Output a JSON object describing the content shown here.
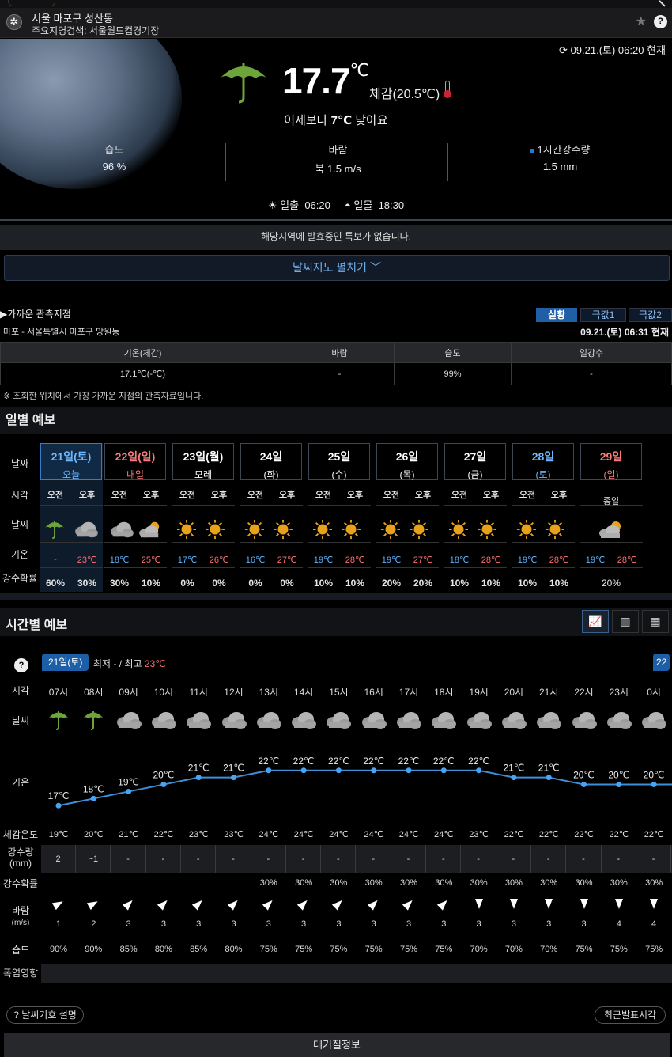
{
  "location": {
    "name": "서울 마포구 성산동",
    "search": "주요지명검색: 서울월드컵경기장"
  },
  "current": {
    "time": "09.21.(토) 06:20 현재",
    "temp": "17.7",
    "unit": "℃",
    "feels": "체감(20.5℃)",
    "compare_prefix": "어제보다",
    "compare_value": "7℃",
    "compare_suffix": "낮아요",
    "humidity_label": "습도",
    "humidity": "96 %",
    "wind_label": "바람",
    "wind": "북 1.5 m/s",
    "rain_label": "1시간강수량",
    "rain": "1.5 mm",
    "sunrise_label": "일출",
    "sunrise": "06:20",
    "sunset_label": "일몰",
    "sunset": "18:30"
  },
  "notice": "해당지역에 발효중인 특보가 없습니다.",
  "map_button": "날씨지도 펼치기",
  "observation": {
    "title": "▶가까운 관측지점",
    "station": "마포 - 서울특별시 마포구 망원동",
    "tabs": [
      "실황",
      "극값1",
      "극값2"
    ],
    "time": "09.21.(토) 06:31 현재",
    "headers": [
      "기온(체감)",
      "바람",
      "습도",
      "일강수"
    ],
    "values": [
      "17.1℃(-℃)",
      "-",
      "99%",
      "-"
    ],
    "note": "※ 조회한 위치에서 가장 가까운 지점의 관측자료입니다."
  },
  "daily": {
    "title": "일별 예보",
    "row_labels": [
      "날짜",
      "시각",
      "날씨",
      "기온",
      "강수확률"
    ],
    "days": [
      {
        "date": "21일(토)",
        "sub": "오늘",
        "am": "오전",
        "pm": "오후",
        "amIcon": "umbrella",
        "pmIcon": "cloud",
        "amT": "-",
        "pmT": "23℃",
        "amP": "60%",
        "pmP": "30%"
      },
      {
        "date": "22일(일)",
        "sub": "내일",
        "am": "오전",
        "pm": "오후",
        "amIcon": "cloud",
        "pmIcon": "suncloud",
        "amT": "18℃",
        "pmT": "25℃",
        "amP": "30%",
        "pmP": "10%"
      },
      {
        "date": "23일(월)",
        "sub": "모레",
        "am": "오전",
        "pm": "오후",
        "amIcon": "sun",
        "pmIcon": "sun",
        "amT": "17℃",
        "pmT": "26℃",
        "amP": "0%",
        "pmP": "0%"
      },
      {
        "date": "24일",
        "sub": "(화)",
        "am": "오전",
        "pm": "오후",
        "amIcon": "sun",
        "pmIcon": "sun",
        "amT": "16℃",
        "pmT": "27℃",
        "amP": "0%",
        "pmP": "0%"
      },
      {
        "date": "25일",
        "sub": "(수)",
        "am": "오전",
        "pm": "오후",
        "amIcon": "sun",
        "pmIcon": "sun",
        "amT": "19℃",
        "pmT": "28℃",
        "amP": "10%",
        "pmP": "10%"
      },
      {
        "date": "26일",
        "sub": "(목)",
        "am": "오전",
        "pm": "오후",
        "amIcon": "sun",
        "pmIcon": "sun",
        "amT": "19℃",
        "pmT": "27℃",
        "amP": "20%",
        "pmP": "20%"
      },
      {
        "date": "27일",
        "sub": "(금)",
        "am": "오전",
        "pm": "오후",
        "amIcon": "sun",
        "pmIcon": "sun",
        "amT": "18℃",
        "pmT": "28℃",
        "amP": "10%",
        "pmP": "10%"
      },
      {
        "date": "28일",
        "sub": "(토)",
        "am": "오전",
        "pm": "오후",
        "amIcon": "sun",
        "pmIcon": "sun",
        "amT": "19℃",
        "pmT": "28℃",
        "amP": "10%",
        "pmP": "10%"
      },
      {
        "date": "29일",
        "sub": "(일)",
        "all": "종일",
        "allIcon": "suncloud",
        "amT": "19℃",
        "pmT": "28℃",
        "allP": "20%"
      }
    ]
  },
  "hourly": {
    "title": "시간별 예보",
    "day_tag": "21일(토)",
    "day_tag_next": "22",
    "minmax_prefix": "최저",
    "min": "-",
    "sep": "/",
    "max_prefix": "최고",
    "max": "23℃",
    "row_labels": {
      "time": "시각",
      "weather": "날씨",
      "temp": "기온",
      "feels": "체감온도",
      "rain": "강수량",
      "rain_unit": "(mm)",
      "prob": "강수확률",
      "wind": "바람",
      "wind_unit": "(m/s)",
      "hum": "습도",
      "heat": "폭염영향"
    },
    "hours": [
      {
        "t": "07시",
        "icon": "umbrella",
        "temp": 17,
        "tl": "17℃",
        "feel": "19℃",
        "rain": "2",
        "prob": "",
        "wdir": 60,
        "ws": "1",
        "hum": "90%"
      },
      {
        "t": "08시",
        "icon": "umbrella",
        "temp": 18,
        "tl": "18℃",
        "feel": "20℃",
        "rain": "~1",
        "prob": "",
        "wdir": 60,
        "ws": "2",
        "hum": "90%"
      },
      {
        "t": "09시",
        "icon": "cloud",
        "temp": 19,
        "tl": "19℃",
        "feel": "21℃",
        "rain": "-",
        "prob": "",
        "wdir": 45,
        "ws": "3",
        "hum": "85%"
      },
      {
        "t": "10시",
        "icon": "cloud",
        "temp": 20,
        "tl": "20℃",
        "feel": "22℃",
        "rain": "-",
        "prob": "",
        "wdir": 45,
        "ws": "3",
        "hum": "80%"
      },
      {
        "t": "11시",
        "icon": "cloud",
        "temp": 21,
        "tl": "21℃",
        "feel": "23℃",
        "rain": "-",
        "prob": "",
        "wdir": 45,
        "ws": "3",
        "hum": "85%"
      },
      {
        "t": "12시",
        "icon": "cloud",
        "temp": 21,
        "tl": "21℃",
        "feel": "23℃",
        "rain": "-",
        "prob": "",
        "wdir": 45,
        "ws": "3",
        "hum": "80%"
      },
      {
        "t": "13시",
        "icon": "cloud",
        "temp": 22,
        "tl": "22℃",
        "feel": "24℃",
        "rain": "-",
        "prob": "30%",
        "wdir": 45,
        "ws": "3",
        "hum": "75%"
      },
      {
        "t": "14시",
        "icon": "cloud",
        "temp": 22,
        "tl": "22℃",
        "feel": "24℃",
        "rain": "-",
        "prob": "30%",
        "wdir": 45,
        "ws": "3",
        "hum": "75%"
      },
      {
        "t": "15시",
        "icon": "cloud",
        "temp": 22,
        "tl": "22℃",
        "feel": "24℃",
        "rain": "-",
        "prob": "30%",
        "wdir": 45,
        "ws": "3",
        "hum": "75%"
      },
      {
        "t": "16시",
        "icon": "cloud",
        "temp": 22,
        "tl": "22℃",
        "feel": "24℃",
        "rain": "-",
        "prob": "30%",
        "wdir": 45,
        "ws": "3",
        "hum": "75%"
      },
      {
        "t": "17시",
        "icon": "cloud",
        "temp": 22,
        "tl": "22℃",
        "feel": "24℃",
        "rain": "-",
        "prob": "30%",
        "wdir": 45,
        "ws": "3",
        "hum": "75%"
      },
      {
        "t": "18시",
        "icon": "cloud",
        "temp": 22,
        "tl": "22℃",
        "feel": "24℃",
        "rain": "-",
        "prob": "30%",
        "wdir": 45,
        "ws": "3",
        "hum": "75%"
      },
      {
        "t": "19시",
        "icon": "cloud",
        "temp": 22,
        "tl": "22℃",
        "feel": "23℃",
        "rain": "-",
        "prob": "30%",
        "wdir": 180,
        "ws": "3",
        "hum": "70%"
      },
      {
        "t": "20시",
        "icon": "cloud",
        "temp": 21,
        "tl": "21℃",
        "feel": "22℃",
        "rain": "-",
        "prob": "30%",
        "wdir": 180,
        "ws": "3",
        "hum": "70%"
      },
      {
        "t": "21시",
        "icon": "cloud",
        "temp": 21,
        "tl": "21℃",
        "feel": "22℃",
        "rain": "-",
        "prob": "30%",
        "wdir": 180,
        "ws": "3",
        "hum": "70%"
      },
      {
        "t": "22시",
        "icon": "cloud",
        "temp": 20,
        "tl": "20℃",
        "feel": "22℃",
        "rain": "-",
        "prob": "30%",
        "wdir": 180,
        "ws": "3",
        "hum": "75%"
      },
      {
        "t": "23시",
        "icon": "cloud",
        "temp": 20,
        "tl": "20℃",
        "feel": "22℃",
        "rain": "-",
        "prob": "30%",
        "wdir": 180,
        "ws": "4",
        "hum": "75%"
      },
      {
        "t": "0시",
        "icon": "cloud",
        "temp": 20,
        "tl": "20℃",
        "feel": "22℃",
        "rain": "-",
        "prob": "30%",
        "wdir": 180,
        "ws": "4",
        "hum": "75%"
      }
    ]
  },
  "footer": {
    "legend_button": "날씨기호 설명",
    "recent_button": "최근발표시각",
    "air": "대기질정보"
  },
  "colors": {
    "accent": "#1e5fa6",
    "link": "#6fb0ee",
    "sat": "#5cb3ff",
    "sun": "#ff6b6b",
    "line": "#3f8fd8"
  }
}
